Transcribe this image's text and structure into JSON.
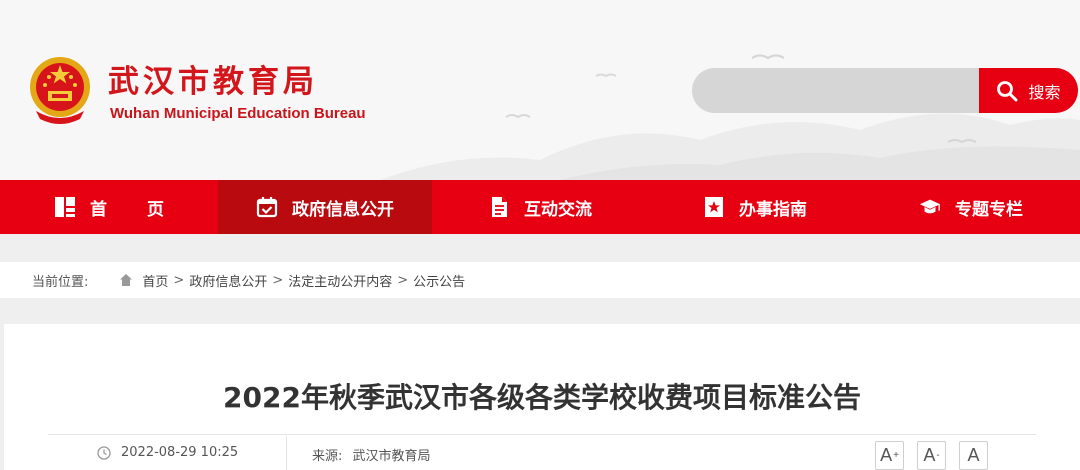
{
  "header": {
    "title": "武汉市教育局",
    "subtitle": "Wuhan Municipal Education Bureau",
    "emblem_icon": "national-emblem-icon"
  },
  "search": {
    "placeholder": "",
    "button_label": "搜索",
    "icon": "search-icon"
  },
  "nav": {
    "items": [
      {
        "label": "首页",
        "icon": "home-grid-icon",
        "active": false
      },
      {
        "label": "政府信息公开",
        "icon": "calendar-check-icon",
        "active": true
      },
      {
        "label": "互动交流",
        "icon": "document-icon",
        "active": false
      },
      {
        "label": "办事指南",
        "icon": "bookmark-star-icon",
        "active": false
      },
      {
        "label": "专题专栏",
        "icon": "graduation-cap-icon",
        "active": false
      }
    ]
  },
  "breadcrumb": {
    "label": "当前位置:",
    "items": [
      "首页",
      "政府信息公开",
      "法定主动公开内容",
      "公示公告"
    ],
    "separator": ">"
  },
  "article": {
    "title": "2022年秋季武汉市各级各类学校收费项目标准公告",
    "date": "2022-08-29 10:25",
    "source_label": "来源:",
    "source": "武汉市教育局",
    "font_sizes": [
      "A",
      "A",
      "A"
    ],
    "font_size_marks": [
      "+",
      "-",
      ""
    ]
  },
  "colors": {
    "brand_red": "#e60012",
    "nav_active": "#b80a0f",
    "title_red": "#d2161b"
  }
}
